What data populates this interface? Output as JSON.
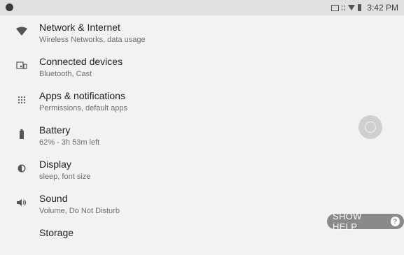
{
  "status_bar": {
    "time": "3:42 PM"
  },
  "settings": {
    "items": [
      {
        "icon": "wifi-icon",
        "title": "Network & Internet",
        "subtitle": "Wireless Networks, data usage"
      },
      {
        "icon": "devices-icon",
        "title": "Connected devices",
        "subtitle": "Bluetooth, Cast"
      },
      {
        "icon": "apps-grid-icon",
        "title": "Apps & notifications",
        "subtitle": "Permissions, default apps"
      },
      {
        "icon": "battery-icon",
        "title": "Battery",
        "subtitle": "62% - 3h 53m left"
      },
      {
        "icon": "brightness-icon",
        "title": "Display",
        "subtitle": "sleep, font size"
      },
      {
        "icon": "volume-icon",
        "title": "Sound",
        "subtitle": "Volume, Do Not Disturb"
      },
      {
        "icon": "storage-icon",
        "title": "Storage",
        "subtitle": ""
      }
    ]
  },
  "help_button": {
    "label": "SHOW HELP",
    "icon": "question-icon"
  },
  "floating_control": {
    "icon": "navigation-ring-icon"
  }
}
